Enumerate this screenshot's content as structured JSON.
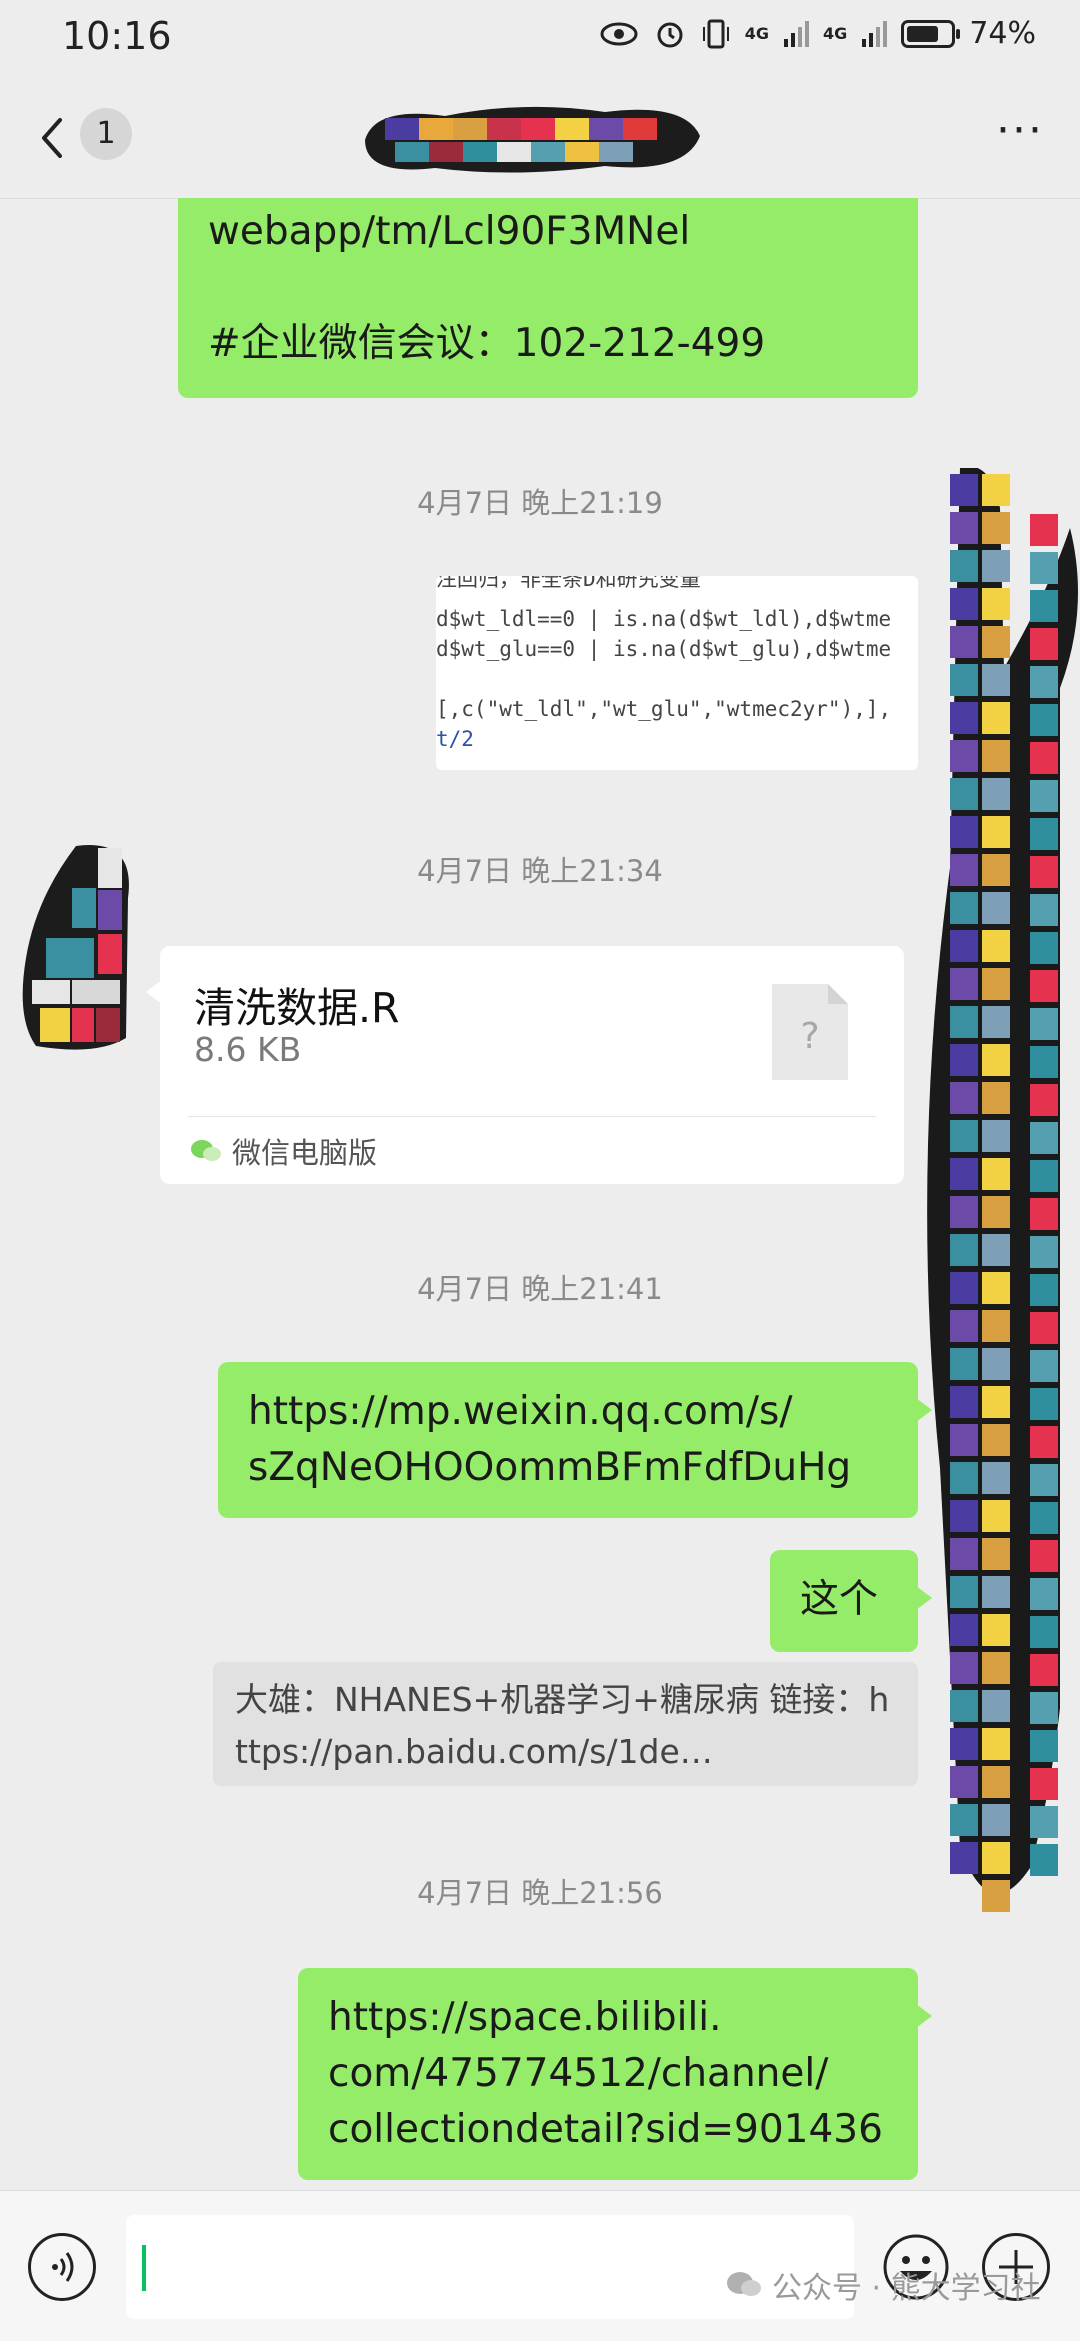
{
  "status_bar": {
    "time": "10:16",
    "network1": "4G",
    "network2": "4G",
    "battery": "74%",
    "battery_level": 0.74
  },
  "nav": {
    "unread_count": "1"
  },
  "messages": {
    "m1_line1": "webapp/tm/Lcl90F3MNel",
    "m1_line2": "#企业微信会议：102-212-499",
    "ts1": "4月7日 晚上21:19",
    "code_lines": [
      "注回归，非全条D和研究变量",
      "d$wt_ldl==0 | is.na(d$wt_ldl),d$wtme",
      "d$wt_glu==0 | is.na(d$wt_glu),d$wtme",
      "",
      "[,c(\"wt_ldl\",\"wt_glu\",\"wtmec2yr\"),],",
      "t/2"
    ],
    "ts2": "4月7日 晚上21:34",
    "file_name": "清洗数据.R",
    "file_size": "8.6 KB",
    "file_source": "微信电脑版",
    "ts3": "4月7日 晚上21:41",
    "link1_line1": "https://mp.weixin.qq.com/s/",
    "link1_line2": "sZqNeOHOOommBFmFdfDuHg",
    "zhege": "这个",
    "quote": "大雄：NHANES+机器学习+糖尿病 链接：https://pan.baidu.com/s/1de…",
    "ts4": "4月7日 晚上21:56",
    "link2_line1": "https://space.bilibili.",
    "link2_line2": "com/475774512/channel/",
    "link2_line3": "collectiondetail?sid=901436"
  },
  "watermark": {
    "text": "公众号 · 熊大学习社"
  },
  "icons": {
    "back": "chevron-left-icon",
    "more": "more-icon",
    "voice": "voice-icon",
    "emoji": "emoji-icon",
    "plus": "plus-icon",
    "file": "unknown-file-icon",
    "wechat": "wechat-icon"
  },
  "colors": {
    "bubble_green": "#95ec69",
    "background": "#ededed",
    "accent": "#07c160"
  }
}
